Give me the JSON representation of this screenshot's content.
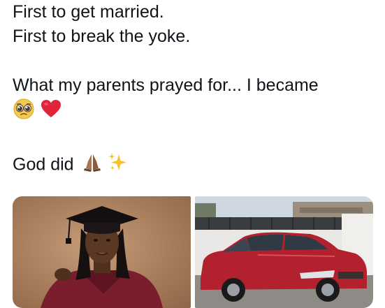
{
  "tweet": {
    "line1": "First to get married.",
    "line2": "First to break the yoke.",
    "line3": "What my parents prayed for... I became",
    "line5": "God did"
  },
  "emojis": {
    "line4": [
      "pleading-face-icon",
      "red-heart-icon"
    ],
    "line5": [
      "folded-hands-icon",
      "sparkles-icon"
    ]
  },
  "media": {
    "photo1": "graduation-portrait-photo",
    "photo2": "red-sedan-car-photo"
  },
  "colors": {
    "text": "#0f1419",
    "heart": "#e0243a",
    "car": "#b3202e",
    "gown": "#7a1e2e",
    "photo_bg": "#b78a67"
  }
}
